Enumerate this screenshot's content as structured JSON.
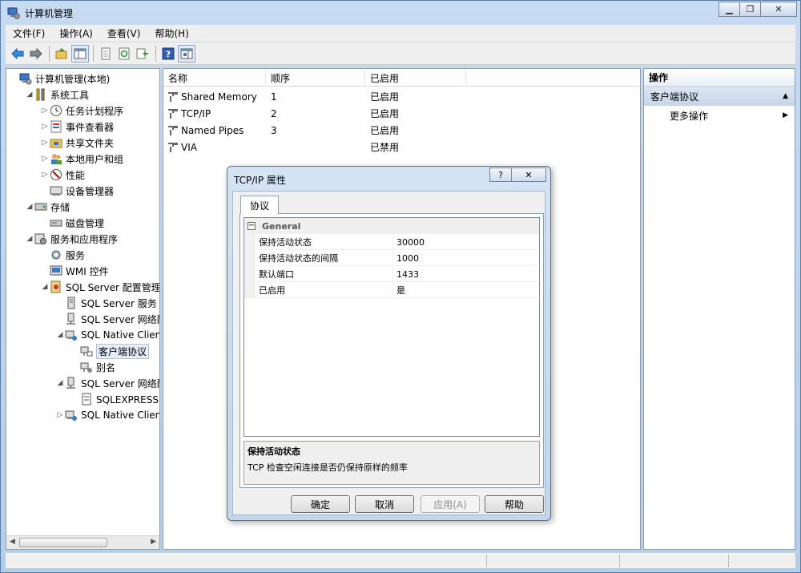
{
  "window": {
    "title": "计算机管理"
  },
  "menu": [
    "文件(F)",
    "操作(A)",
    "查看(V)",
    "帮助(H)"
  ],
  "tree": [
    {
      "label": "计算机管理(本地)",
      "level": 0,
      "expander": "",
      "icon": "computer-icon"
    },
    {
      "label": "系统工具",
      "level": 1,
      "expander": "open",
      "icon": "tools-icon"
    },
    {
      "label": "任务计划程序",
      "level": 2,
      "expander": "closed",
      "icon": "clock-icon"
    },
    {
      "label": "事件查看器",
      "level": 2,
      "expander": "closed",
      "icon": "event-log-icon"
    },
    {
      "label": "共享文件夹",
      "level": 2,
      "expander": "closed",
      "icon": "shared-folder-icon"
    },
    {
      "label": "本地用户和组",
      "level": 2,
      "expander": "closed",
      "icon": "users-icon"
    },
    {
      "label": "性能",
      "level": 2,
      "expander": "closed",
      "icon": "performance-icon"
    },
    {
      "label": "设备管理器",
      "level": 2,
      "expander": "",
      "icon": "device-manager-icon"
    },
    {
      "label": "存储",
      "level": 1,
      "expander": "open",
      "icon": "storage-icon"
    },
    {
      "label": "磁盘管理",
      "level": 2,
      "expander": "",
      "icon": "disk-icon"
    },
    {
      "label": "服务和应用程序",
      "level": 1,
      "expander": "open",
      "icon": "services-apps-icon"
    },
    {
      "label": "服务",
      "level": 2,
      "expander": "",
      "icon": "gear-icon"
    },
    {
      "label": "WMI 控件",
      "level": 2,
      "expander": "",
      "icon": "wmi-icon"
    },
    {
      "label": "SQL Server 配置管理器",
      "level": 2,
      "expander": "open",
      "icon": "sql-config-icon"
    },
    {
      "label": "SQL Server 服务",
      "level": 3,
      "expander": "",
      "icon": "server-icon"
    },
    {
      "label": "SQL Server 网络配置",
      "level": 3,
      "expander": "",
      "icon": "network-icon"
    },
    {
      "label": "SQL Native Client",
      "level": 3,
      "expander": "open",
      "icon": "client-icon"
    },
    {
      "label": "客户端协议",
      "level": 4,
      "expander": "",
      "icon": "protocol-icon",
      "selected": true
    },
    {
      "label": "别名",
      "level": 4,
      "expander": "",
      "icon": "alias-icon"
    },
    {
      "label": "SQL Server 网络配置",
      "level": 3,
      "expander": "open",
      "icon": "network-icon"
    },
    {
      "label": "SQLEXPRESS 的",
      "level": 4,
      "expander": "",
      "icon": "instance-icon"
    },
    {
      "label": "SQL Native Client",
      "level": 3,
      "expander": "closed",
      "icon": "client-icon"
    }
  ],
  "list": {
    "columns": [
      "名称",
      "顺序",
      "已启用"
    ],
    "rows": [
      {
        "name": "Shared Memory",
        "order": "1",
        "enabled": "已启用"
      },
      {
        "name": "TCP/IP",
        "order": "2",
        "enabled": "已启用"
      },
      {
        "name": "Named Pipes",
        "order": "3",
        "enabled": "已启用"
      },
      {
        "name": "VIA",
        "order": "",
        "enabled": "已禁用"
      }
    ]
  },
  "actions": {
    "header": "操作",
    "section": "客户端协议",
    "item": "更多操作"
  },
  "dialog": {
    "title": "TCP/IP 属性",
    "help_glyph": "?",
    "tab": "协议",
    "category": "General",
    "properties": [
      {
        "key": "保持活动状态",
        "value": "30000"
      },
      {
        "key": "保持活动状态的间隔",
        "value": "1000"
      },
      {
        "key": "默认端口",
        "value": "1433"
      },
      {
        "key": "已启用",
        "value": "是"
      }
    ],
    "desc_title": "保持活动状态",
    "desc_text": "TCP 检查空闲连接是否仍保持原样的频率",
    "buttons": {
      "ok": "确定",
      "cancel": "取消",
      "apply": "应用(A)",
      "help": "帮助"
    }
  }
}
